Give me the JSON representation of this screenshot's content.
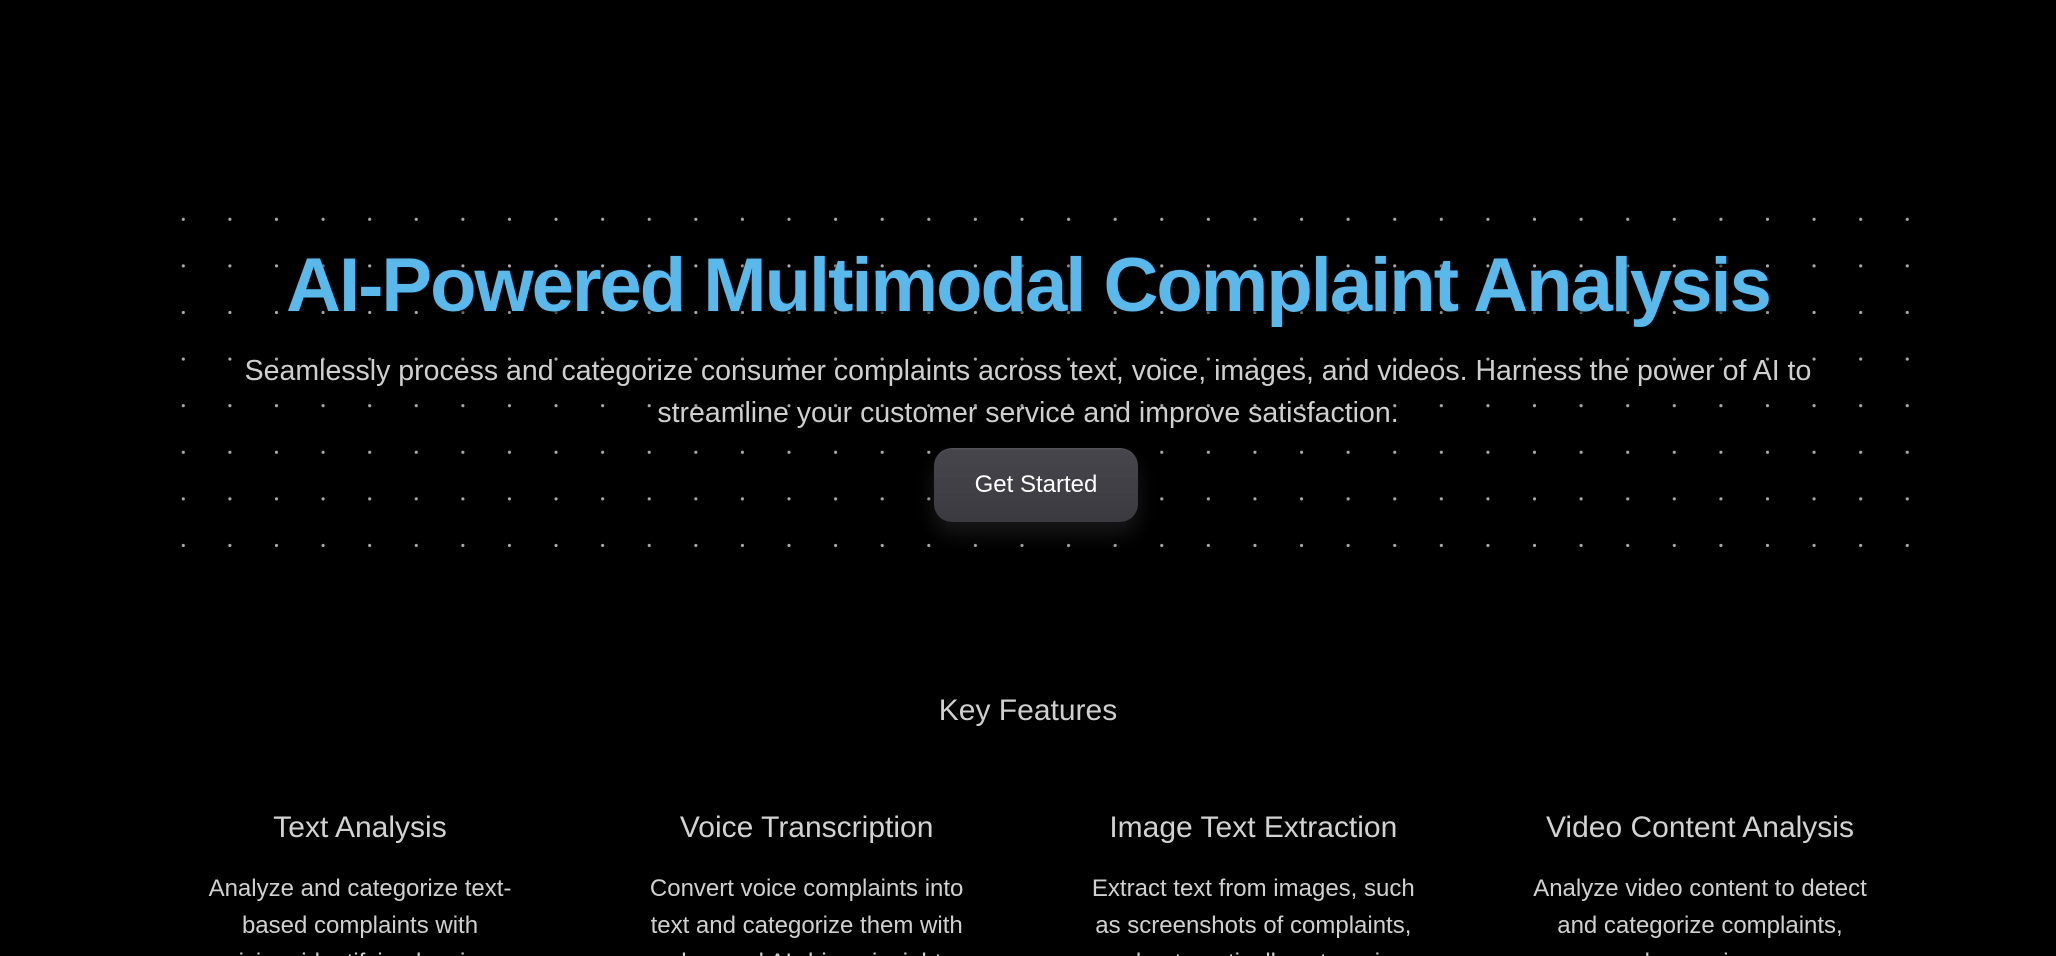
{
  "hero": {
    "title": "AI-Powered Multimodal Complaint Analysis",
    "subtitle": "Seamlessly process and categorize consumer complaints across text, voice, images, and videos. Harness the power of AI to streamline your customer service and improve satisfaction.",
    "cta_label": "Get Started"
  },
  "features": {
    "heading": "Key Features",
    "items": [
      {
        "title": "Text Analysis",
        "description": "Analyze and categorize text-based complaints with precision, identifying key issues"
      },
      {
        "title": "Voice Transcription",
        "description": "Convert voice complaints into text and categorize them with advanced AI-driven insights"
      },
      {
        "title": "Image Text Extraction",
        "description": "Extract text from images, such as screenshots of complaints, and automatically categorize"
      },
      {
        "title": "Video Content Analysis",
        "description": "Analyze video content to detect and categorize complaints, leveraging"
      }
    ]
  },
  "colors": {
    "background": "#000000",
    "title_accent": "#5ab9ea",
    "button": "#3f3f45"
  }
}
